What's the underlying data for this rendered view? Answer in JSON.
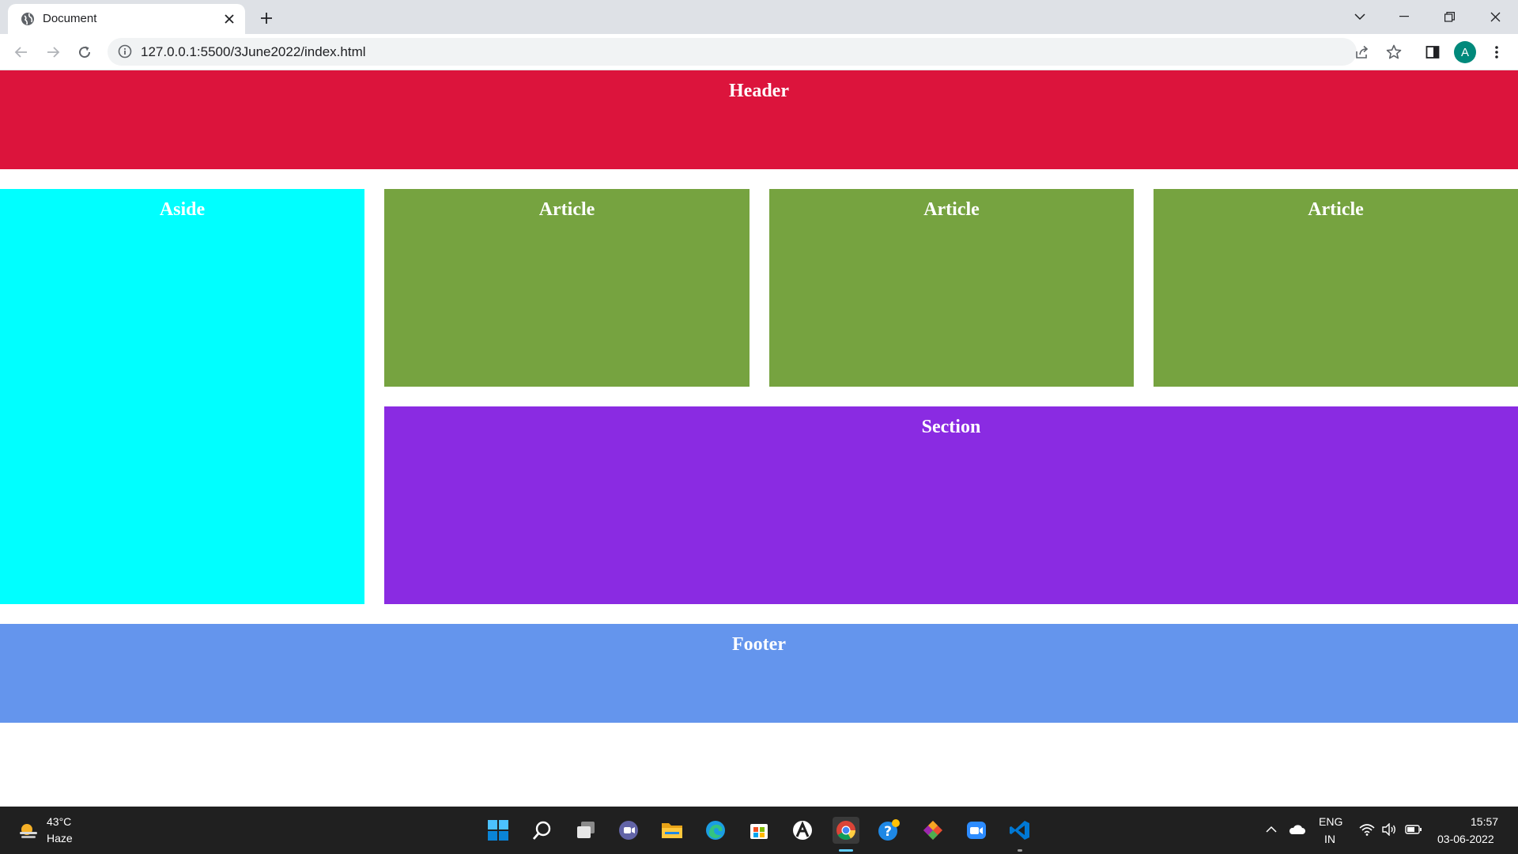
{
  "browser": {
    "tab": {
      "title": "Document",
      "favicon": "globe-icon",
      "close_icon": "close-icon"
    },
    "new_tab_icon": "plus-icon",
    "window_controls": [
      "chevron-down-icon",
      "minimize-icon",
      "restore-icon",
      "close-icon"
    ],
    "toolbar": {
      "back_icon": "back-arrow-icon",
      "forward_icon": "forward-arrow-icon",
      "reload_icon": "reload-icon",
      "url": "127.0.0.1:5500/3June2022/index.html",
      "profile_initial": "A",
      "profile_color": "#00897b"
    }
  },
  "page": {
    "header": {
      "label": "Header",
      "color": "#dc143c"
    },
    "aside": {
      "label": "Aside",
      "color": "#00ffff"
    },
    "articles": [
      {
        "label": "Article",
        "color": "#76a340"
      },
      {
        "label": "Article",
        "color": "#76a340"
      },
      {
        "label": "Article",
        "color": "#76a340"
      }
    ],
    "section": {
      "label": "Section",
      "color": "#8a2be2"
    },
    "footer": {
      "label": "Footer",
      "color": "#6495ed"
    }
  },
  "taskbar": {
    "weather": {
      "temp": "43°C",
      "condition": "Haze",
      "icon": "weather-haze-icon"
    },
    "apps": [
      "start-icon",
      "search-icon",
      "task-view-icon",
      "chat-icon",
      "file-explorer-icon",
      "edge-icon",
      "store-icon",
      "app-icon",
      "chrome-icon",
      "help-icon",
      "git-icon",
      "zoom-icon",
      "vscode-icon"
    ],
    "tray": {
      "language": "ENG",
      "region": "IN",
      "time": "15:57",
      "date": "03-06-2022"
    }
  }
}
